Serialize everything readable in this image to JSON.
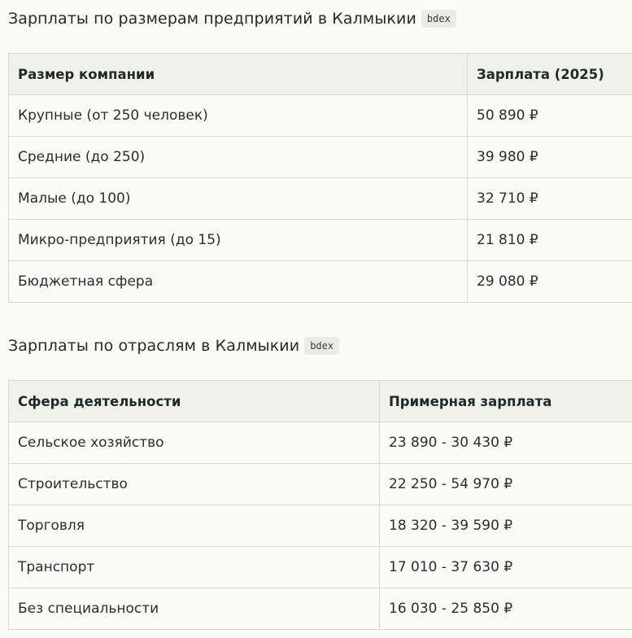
{
  "sections": [
    {
      "title": "Зарплаты по размерам предприятий в Калмыкии",
      "badge": "bdex",
      "columns": [
        "Размер компании",
        "Зарплата (2025)"
      ],
      "rows": [
        [
          "Крупные (от 250 человек)",
          "50 890 ₽"
        ],
        [
          "Средние (до 250)",
          "39 980 ₽"
        ],
        [
          "Малые (до 100)",
          "32 710 ₽"
        ],
        [
          "Микро-предприятия (до 15)",
          "21 810 ₽"
        ],
        [
          "Бюджетная сфера",
          "29 080 ₽"
        ]
      ]
    },
    {
      "title": "Зарплаты по отраслям в Калмыкии",
      "badge": "bdex",
      "columns": [
        "Сфера деятельности",
        "Примерная зарплата"
      ],
      "rows": [
        [
          "Сельское хозяйство",
          "23 890 - 30 430 ₽"
        ],
        [
          "Строительство",
          "22 250 - 54 970 ₽"
        ],
        [
          "Торговля",
          "18 320 - 39 590 ₽"
        ],
        [
          "Транспорт",
          "17 010 - 37 630 ₽"
        ],
        [
          "Без специальности",
          "16 030 - 25 850 ₽"
        ]
      ]
    }
  ]
}
